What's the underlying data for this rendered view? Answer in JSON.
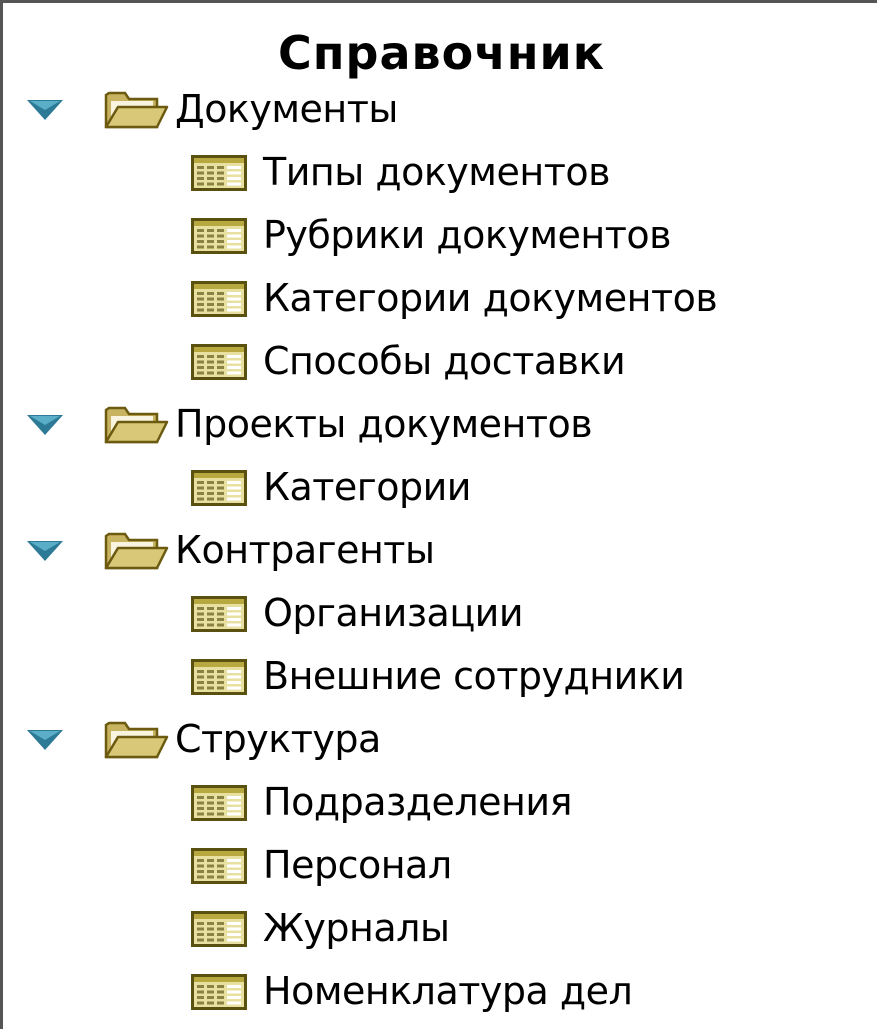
{
  "panel": {
    "title": "Справочник"
  },
  "tree": [
    {
      "label": "Документы",
      "icon": "folder-open-icon",
      "expanded": true,
      "children": [
        {
          "label": "Типы документов",
          "icon": "table-icon"
        },
        {
          "label": "Рубрики документов",
          "icon": "table-icon"
        },
        {
          "label": "Категории документов",
          "icon": "table-icon"
        },
        {
          "label": "Способы доставки",
          "icon": "table-icon"
        }
      ]
    },
    {
      "label": "Проекты документов",
      "icon": "folder-open-icon",
      "expanded": true,
      "children": [
        {
          "label": "Категории",
          "icon": "table-icon"
        }
      ]
    },
    {
      "label": "Контрагенты",
      "icon": "folder-open-icon",
      "expanded": true,
      "children": [
        {
          "label": "Организации",
          "icon": "table-icon"
        },
        {
          "label": "Внешние сотрудники",
          "icon": "table-icon"
        }
      ]
    },
    {
      "label": "Структура",
      "icon": "folder-open-icon",
      "expanded": true,
      "children": [
        {
          "label": "Подразделения",
          "icon": "table-icon"
        },
        {
          "label": "Персонал",
          "icon": "table-icon"
        },
        {
          "label": "Журналы",
          "icon": "table-icon"
        },
        {
          "label": "Номенклатура дел",
          "icon": "table-icon"
        }
      ]
    }
  ],
  "colors": {
    "arrow": "#2d7a96",
    "folder": "#d8c878",
    "folder_outline": "#6b5a10",
    "table_icon_fill": "#e8e0a0",
    "table_icon_outline": "#5a5010"
  }
}
